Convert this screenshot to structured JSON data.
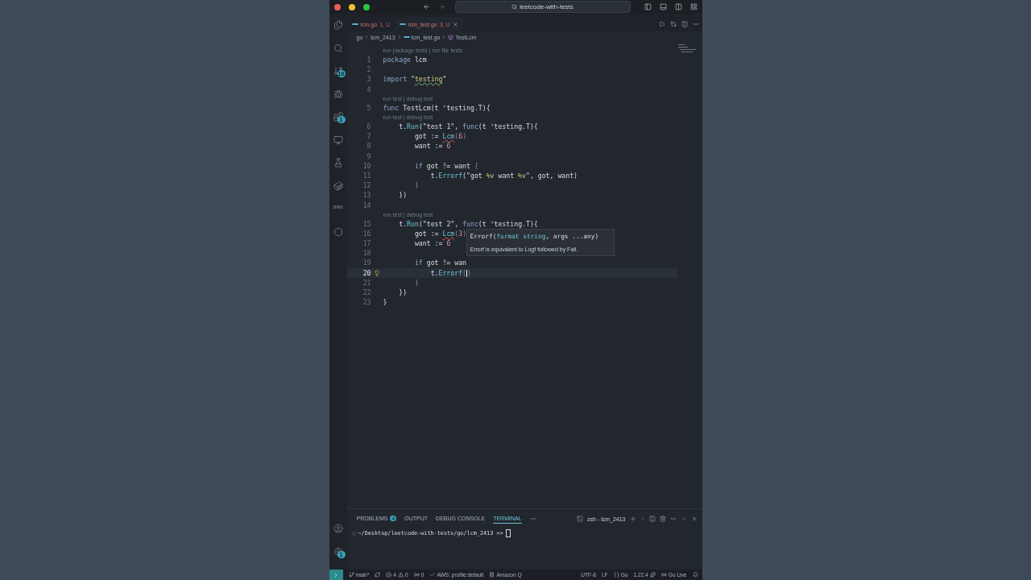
{
  "title_bar": {
    "search": "leetcode-with-tests"
  },
  "activity_bar": {
    "top": [
      {
        "kind": "files"
      },
      {
        "kind": "search"
      },
      {
        "kind": "scm",
        "badge": "10"
      },
      {
        "kind": "run"
      },
      {
        "kind": "extensions",
        "badge": "1"
      },
      {
        "kind": "remote"
      },
      {
        "kind": "testing"
      },
      {
        "kind": "docker"
      },
      {
        "kind": "aws",
        "text": "aws"
      },
      {
        "kind": "hexagon"
      }
    ],
    "bottom": [
      {
        "kind": "account"
      },
      {
        "kind": "settings",
        "badge": "1"
      }
    ]
  },
  "tabs": [
    {
      "name": "lcm.go",
      "status": "1, U",
      "selected": false
    },
    {
      "name": "lcm_test.go",
      "status": "3, U",
      "selected": true
    }
  ],
  "breadcrumbs": [
    {
      "kind": "folder",
      "text": "go"
    },
    {
      "kind": "folder",
      "text": "lcm_2413"
    },
    {
      "kind": "file",
      "text": "lcm_test.go"
    },
    {
      "kind": "symbol",
      "text": "TestLcm"
    }
  ],
  "lines": [
    {
      "number": "1",
      "current": false,
      "lens": "run package tests | run file tests",
      "tokens": [
        {
          "kind": "kw",
          "text": "package"
        },
        {
          "kind": "plain",
          "text": " lcm"
        }
      ]
    },
    {
      "number": "2",
      "current": false
    },
    {
      "number": "3",
      "current": false,
      "tokens": [
        {
          "kind": "kw",
          "text": "import"
        },
        {
          "kind": "plain",
          "text": " \""
        },
        {
          "kind": "pkg",
          "text": "testing",
          "hint_squiggle": true
        },
        {
          "kind": "plain",
          "text": "\""
        }
      ]
    },
    {
      "number": "4",
      "current": false
    },
    {
      "number": "5",
      "current": false,
      "lens": "run test | debug test",
      "tokens": [
        {
          "kind": "kw",
          "text": "func"
        },
        {
          "kind": "plain",
          "text": " TestLcm(t "
        },
        {
          "kind": "punct",
          "text": "*"
        },
        {
          "kind": "plain",
          "text": "testing.T){"
        }
      ]
    },
    {
      "number": "6",
      "current": false,
      "lens": "run test | debug test",
      "tokens": [
        {
          "kind": "plain",
          "text": "    t."
        },
        {
          "kind": "fn",
          "text": "Run"
        },
        {
          "kind": "plain",
          "text": "(\"test 1\", "
        },
        {
          "kind": "kw",
          "text": "func"
        },
        {
          "kind": "plain",
          "text": "(t "
        },
        {
          "kind": "punct",
          "text": "*"
        },
        {
          "kind": "plain",
          "text": "testing.T){"
        }
      ]
    },
    {
      "number": "7",
      "current": false,
      "tokens": [
        {
          "kind": "plain",
          "text": "        got := "
        },
        {
          "kind": "fn",
          "text": "Lcm",
          "error_squiggle": true
        },
        {
          "kind": "punct",
          "text": "("
        },
        {
          "kind": "num",
          "text": "6"
        },
        {
          "kind": "punct",
          "text": ")"
        }
      ]
    },
    {
      "number": "8",
      "current": false,
      "tokens": [
        {
          "kind": "plain",
          "text": "        want := "
        },
        {
          "kind": "num",
          "text": "6"
        }
      ]
    },
    {
      "number": "9",
      "current": false
    },
    {
      "number": "10",
      "current": false,
      "tokens": [
        {
          "kind": "kw",
          "text": "        if"
        },
        {
          "kind": "plain",
          "text": " got != want "
        },
        {
          "kind": "punct",
          "text": "{"
        }
      ]
    },
    {
      "number": "11",
      "current": false,
      "tokens": [
        {
          "kind": "plain",
          "text": "            t."
        },
        {
          "kind": "fn",
          "text": "Errorf"
        },
        {
          "kind": "plain",
          "text": "(\"got "
        },
        {
          "kind": "fmt",
          "text": "%v"
        },
        {
          "kind": "plain",
          "text": " want "
        },
        {
          "kind": "fmt",
          "text": "%v"
        },
        {
          "kind": "plain",
          "text": "\", got, want)"
        }
      ]
    },
    {
      "number": "12",
      "current": false,
      "tokens": [
        {
          "kind": "punct",
          "text": "        }"
        }
      ]
    },
    {
      "number": "13",
      "current": false,
      "tokens": [
        {
          "kind": "plain",
          "text": "    })"
        }
      ]
    },
    {
      "number": "14",
      "current": false
    },
    {
      "number": "15",
      "current": false,
      "lens": "run test | debug test",
      "tokens": [
        {
          "kind": "plain",
          "text": "    t."
        },
        {
          "kind": "fn",
          "text": "Run"
        },
        {
          "kind": "plain",
          "text": "(\"test 2\", "
        },
        {
          "kind": "kw",
          "text": "func"
        },
        {
          "kind": "plain",
          "text": "(t "
        },
        {
          "kind": "punct",
          "text": "*"
        },
        {
          "kind": "plain",
          "text": "testing.T){"
        }
      ]
    },
    {
      "number": "16",
      "current": false,
      "tokens": [
        {
          "kind": "plain",
          "text": "        got := "
        },
        {
          "kind": "fn",
          "text": "Lcm",
          "error_squiggle": true
        },
        {
          "kind": "punct",
          "text": "("
        },
        {
          "kind": "num",
          "text": "3"
        },
        {
          "kind": "punct",
          "text": ")"
        }
      ]
    },
    {
      "number": "17",
      "current": false,
      "tokens": [
        {
          "kind": "plain",
          "text": "        want := "
        },
        {
          "kind": "num",
          "text": "6"
        }
      ]
    },
    {
      "number": "18",
      "current": false
    },
    {
      "number": "19",
      "current": false,
      "tokens": [
        {
          "kind": "kw",
          "text": "        if"
        },
        {
          "kind": "plain",
          "text": " got != wan"
        }
      ]
    },
    {
      "number": "20",
      "current": true,
      "tokens": [
        {
          "kind": "plain",
          "text": "            t."
        },
        {
          "kind": "fn",
          "text": "Errorf"
        },
        {
          "kind": "punct",
          "text": "(",
          "cursor_after": true
        },
        {
          "kind": "punct",
          "text": ")"
        }
      ]
    },
    {
      "number": "21",
      "current": false,
      "tokens": [
        {
          "kind": "punct",
          "text": "        }"
        }
      ]
    },
    {
      "number": "22",
      "current": false,
      "tokens": [
        {
          "kind": "plain",
          "text": "    })"
        }
      ]
    },
    {
      "number": "23",
      "current": false,
      "tokens": [
        {
          "kind": "plain",
          "text": "}"
        }
      ]
    }
  ],
  "hover": {
    "signature": "Errorf(**format string**, args ...any)",
    "doc": "Errorf is equivalent to Logf followed by Fail."
  },
  "panel": {
    "tabs": [
      {
        "label": "PROBLEMS",
        "badge": "4",
        "selected": false
      },
      {
        "label": "OUTPUT",
        "selected": false
      },
      {
        "label": "DEBUG CONSOLE",
        "selected": false
      },
      {
        "label": "TERMINAL",
        "selected": true
      }
    ],
    "terminal_name": "zsh - lcm_2413",
    "prompt": "~/Desktop/leetcode-with-tests/go/lcm_2413 >>"
  },
  "status_bar": {
    "left": [
      {
        "kind": "branch",
        "text": "main*"
      },
      {
        "kind": "sync"
      },
      {
        "kind": "problems",
        "errors": "4",
        "warnings": "0"
      },
      {
        "kind": "ports",
        "text": "0"
      },
      {
        "kind": "check",
        "text": "AWS: profile:default"
      },
      {
        "kind": "pause",
        "text": "Amazon Q"
      }
    ],
    "right": [
      {
        "kind": "plain",
        "text": "UTF-8"
      },
      {
        "kind": "plain",
        "text": "LF"
      },
      {
        "kind": "braces",
        "text": "Go"
      },
      {
        "kind": "version",
        "text": "1.22.4"
      },
      {
        "kind": "live",
        "text": "Go Live"
      },
      {
        "kind": "bell"
      }
    ]
  }
}
